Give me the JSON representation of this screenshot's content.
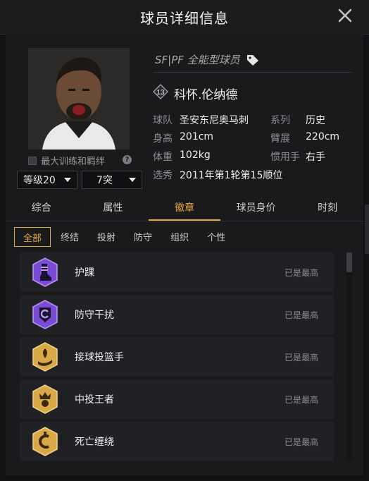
{
  "header": {
    "title": "球员详细信息"
  },
  "player": {
    "type_label": "SF|PF 全能型球员",
    "number": "13",
    "name": "科怀.伦纳德",
    "training_label": "最大训练和羁绊",
    "level": "等级20",
    "tier": "7突"
  },
  "info": {
    "team_label": "球队",
    "team": "圣安东尼奥马刺",
    "series_label": "系列",
    "series": "历史",
    "height_label": "身高",
    "height": "201cm",
    "wingspan_label": "臂展",
    "wingspan": "220cm",
    "weight_label": "体重",
    "weight": "102kg",
    "hand_label": "惯用手",
    "hand": "右手",
    "draft_label": "选秀",
    "draft": "2011年第1轮第15顺位"
  },
  "tabs": [
    "综合",
    "属性",
    "徽章",
    "球员身价",
    "时刻"
  ],
  "active_tab": 2,
  "subtabs": [
    "全部",
    "终结",
    "投射",
    "防守",
    "组织",
    "个性"
  ],
  "badges": [
    {
      "name": "护踝",
      "status": "已是最高",
      "icon": "ankle-brace-icon",
      "color": "purple"
    },
    {
      "name": "防守干扰",
      "status": "已是最高",
      "icon": "defensive-disruption-icon",
      "color": "purple"
    },
    {
      "name": "接球投篮手",
      "status": "已是最高",
      "icon": "catch-and-shoot-icon",
      "color": "gold"
    },
    {
      "name": "中投王者",
      "status": "已是最高",
      "icon": "midrange-king-icon",
      "color": "gold"
    },
    {
      "name": "死亡缠绕",
      "status": "已是最高",
      "icon": "death-grip-icon",
      "color": "gold"
    }
  ],
  "colors": {
    "accent": "#e8a43d",
    "purple": "#7b4bd6",
    "gold": "#d9a948"
  }
}
